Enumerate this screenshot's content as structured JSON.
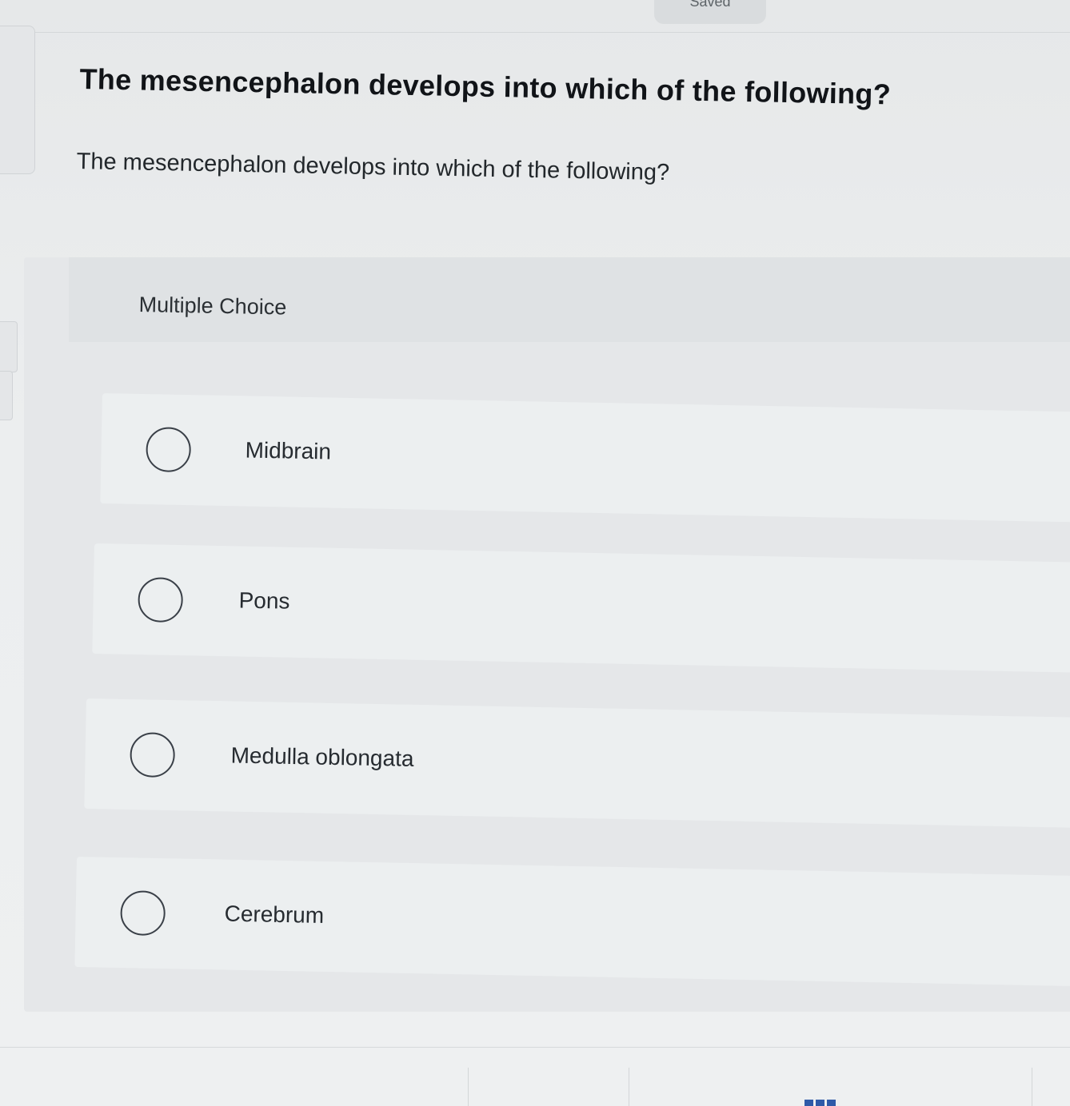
{
  "status": {
    "saved_label": "Saved"
  },
  "question": {
    "title": "The mesencephalon develops into which of the following?",
    "body": "The mesencephalon develops into which of the following?"
  },
  "answer_block": {
    "type_label": "Multiple Choice",
    "options": [
      {
        "label": "Midbrain",
        "selected": false
      },
      {
        "label": "Pons",
        "selected": false
      },
      {
        "label": "Medulla oblongata",
        "selected": false
      },
      {
        "label": "Cerebrum",
        "selected": false
      }
    ]
  },
  "footer": {
    "grid_icon": "grid-icon",
    "accent_color": "#2f5aa8"
  }
}
